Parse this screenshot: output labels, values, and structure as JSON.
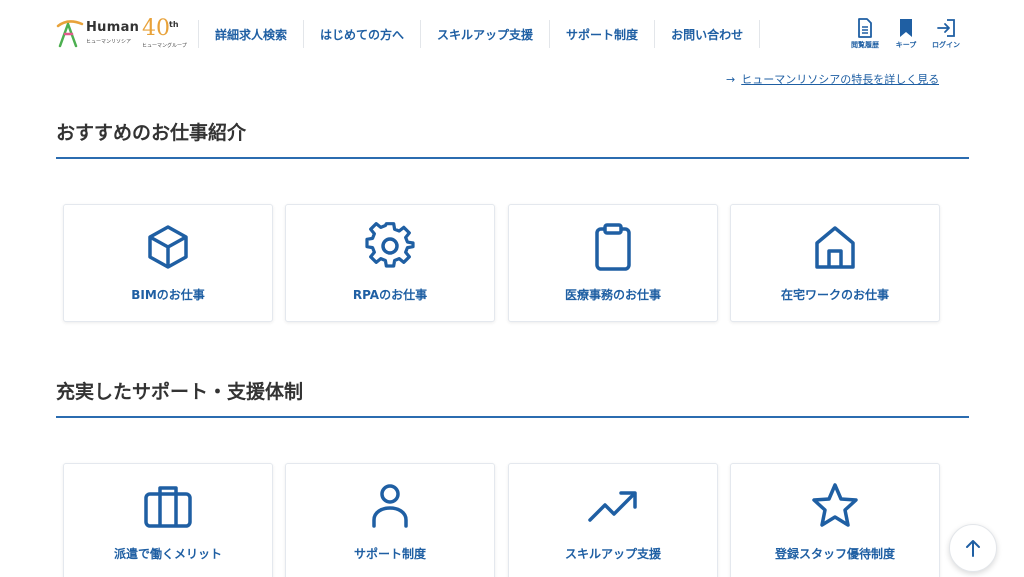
{
  "header": {
    "logo": {
      "brand": "Human",
      "brand_sub": "ヒューマンリソシア",
      "anniversary_number": "40",
      "anniversary_suffix": "th",
      "group_sub": "ヒューマングループ"
    },
    "nav": [
      {
        "label": "詳細求人検索"
      },
      {
        "label": "はじめての方へ"
      },
      {
        "label": "スキルアップ支援"
      },
      {
        "label": "サポート制度"
      },
      {
        "label": "お問い合わせ"
      }
    ],
    "utility": {
      "history_label": "閲覧履歴",
      "keep_label": "キープ",
      "login_label": "ログイン"
    }
  },
  "top_link": {
    "arrow": "→",
    "text": "ヒューマンリソシアの特長を詳しく見る"
  },
  "sections": [
    {
      "title": "おすすめのお仕事紹介",
      "cards": [
        {
          "label": "BIMのお仕事",
          "icon": "cube-icon"
        },
        {
          "label": "RPAのお仕事",
          "icon": "gear-icon"
        },
        {
          "label": "医療事務のお仕事",
          "icon": "clipboard-icon"
        },
        {
          "label": "在宅ワークのお仕事",
          "icon": "home-icon"
        }
      ]
    },
    {
      "title": "充実したサポート・支援体制",
      "cards": [
        {
          "label": "派遣で働くメリット",
          "icon": "briefcase-icon"
        },
        {
          "label": "サポート制度",
          "icon": "person-icon"
        },
        {
          "label": "スキルアップ支援",
          "icon": "trending-up-icon"
        },
        {
          "label": "登録スタッフ優待制度",
          "icon": "star-icon"
        }
      ]
    }
  ],
  "colors": {
    "accent": "#1f5fa3",
    "rule": "#2b6cb0",
    "logo_orange": "#e8a23a"
  }
}
